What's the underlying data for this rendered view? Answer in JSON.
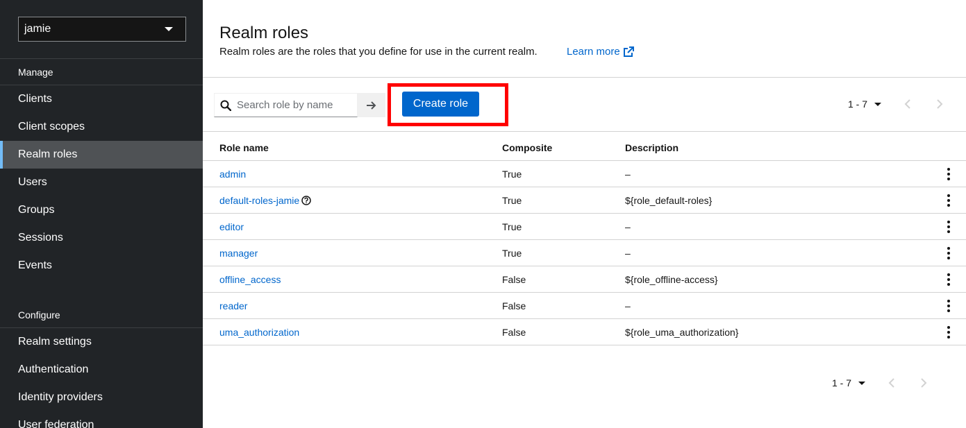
{
  "sidebar": {
    "realm": "jamie",
    "sections": [
      {
        "title": "Manage",
        "items": [
          "Clients",
          "Client scopes",
          "Realm roles",
          "Users",
          "Groups",
          "Sessions",
          "Events"
        ]
      },
      {
        "title": "Configure",
        "items": [
          "Realm settings",
          "Authentication",
          "Identity providers",
          "User federation"
        ]
      }
    ],
    "active_item": "Realm roles"
  },
  "header": {
    "title": "Realm roles",
    "description": "Realm roles are the roles that you define for use in the current realm.",
    "learn_more": "Learn more"
  },
  "toolbar": {
    "search_placeholder": "Search role by name",
    "create_label": "Create role",
    "pagination": "1 - 7"
  },
  "table": {
    "columns": [
      "Role name",
      "Composite",
      "Description"
    ],
    "rows": [
      {
        "name": "admin",
        "composite": "True",
        "description": "–",
        "help": false
      },
      {
        "name": "default-roles-jamie",
        "composite": "True",
        "description": "${role_default-roles}",
        "help": true
      },
      {
        "name": "editor",
        "composite": "True",
        "description": "–",
        "help": false
      },
      {
        "name": "manager",
        "composite": "True",
        "description": "–",
        "help": false
      },
      {
        "name": "offline_access",
        "composite": "False",
        "description": "${role_offline-access}",
        "help": false
      },
      {
        "name": "reader",
        "composite": "False",
        "description": "–",
        "help": false
      },
      {
        "name": "uma_authorization",
        "composite": "False",
        "description": "${role_uma_authorization}",
        "help": false
      }
    ]
  },
  "footer": {
    "pagination": "1 - 7"
  },
  "colors": {
    "sidebar_bg": "#212427",
    "active_bg": "#4f5255",
    "link": "#0066cc",
    "primary": "#0066cc",
    "highlight": "#ff0000"
  }
}
